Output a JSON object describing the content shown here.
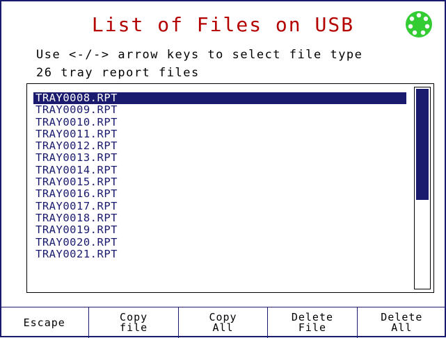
{
  "header": {
    "title": "List of Files on USB",
    "instruction": "Use <-/-> arrow keys to select file type",
    "count_text": "26 tray report files",
    "usb_icon": "usb-connector-icon",
    "usb_icon_color": "#33cc33"
  },
  "file_list": {
    "selected_index": 0,
    "items": [
      "TRAY0008.RPT",
      "TRAY0009.RPT",
      "TRAY0010.RPT",
      "TRAY0011.RPT",
      "TRAY0012.RPT",
      "TRAY0013.RPT",
      "TRAY0014.RPT",
      "TRAY0015.RPT",
      "TRAY0016.RPT",
      "TRAY0017.RPT",
      "TRAY0018.RPT",
      "TRAY0019.RPT",
      "TRAY0020.RPT",
      "TRAY0021.RPT"
    ]
  },
  "softkeys": [
    {
      "name": "escape-button",
      "line1": "Escape",
      "line2": ""
    },
    {
      "name": "copy-file-button",
      "line1": "Copy",
      "line2": "file"
    },
    {
      "name": "copy-all-button",
      "line1": "Copy",
      "line2": "All"
    },
    {
      "name": "delete-file-button",
      "line1": "Delete",
      "line2": "File"
    },
    {
      "name": "delete-all-button",
      "line1": "Delete",
      "line2": "All"
    }
  ],
  "colors": {
    "title": "#b40000",
    "accent": "#1a1a6e"
  }
}
